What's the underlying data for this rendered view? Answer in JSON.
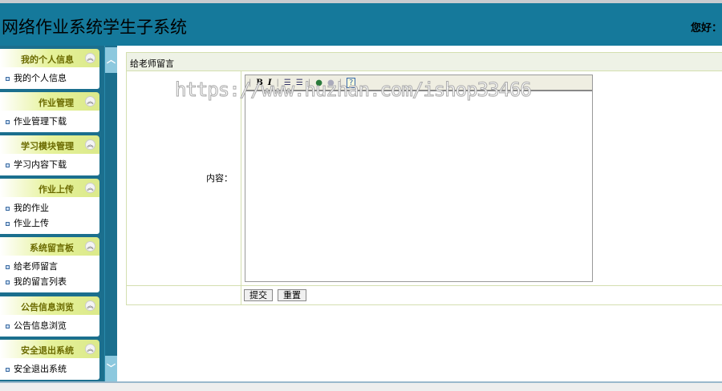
{
  "header": {
    "title": "网络作业系统学生子系统",
    "greeting": "您好："
  },
  "sidebar": [
    {
      "title": "我的个人信息",
      "items": [
        "我的个人信息"
      ]
    },
    {
      "title": "作业管理",
      "items": [
        "作业管理下载"
      ]
    },
    {
      "title": "学习模块管理",
      "items": [
        "学习内容下载"
      ]
    },
    {
      "title": "作业上传",
      "items": [
        "我的作业",
        "作业上传"
      ]
    },
    {
      "title": "系统留言板",
      "items": [
        "给老师留言",
        "我的留言列表"
      ]
    },
    {
      "title": "公告信息浏览",
      "items": [
        "公告信息浏览"
      ]
    },
    {
      "title": "安全退出系统",
      "items": [
        "安全退出系统"
      ]
    }
  ],
  "form": {
    "heading": "给老师留言",
    "content_label": "内容：",
    "submit": "提交",
    "reset": "重置"
  },
  "editor": {
    "bold": "B",
    "italic": "I",
    "help": "?"
  },
  "watermark": "https://www.huzhan.com/ishop33466"
}
